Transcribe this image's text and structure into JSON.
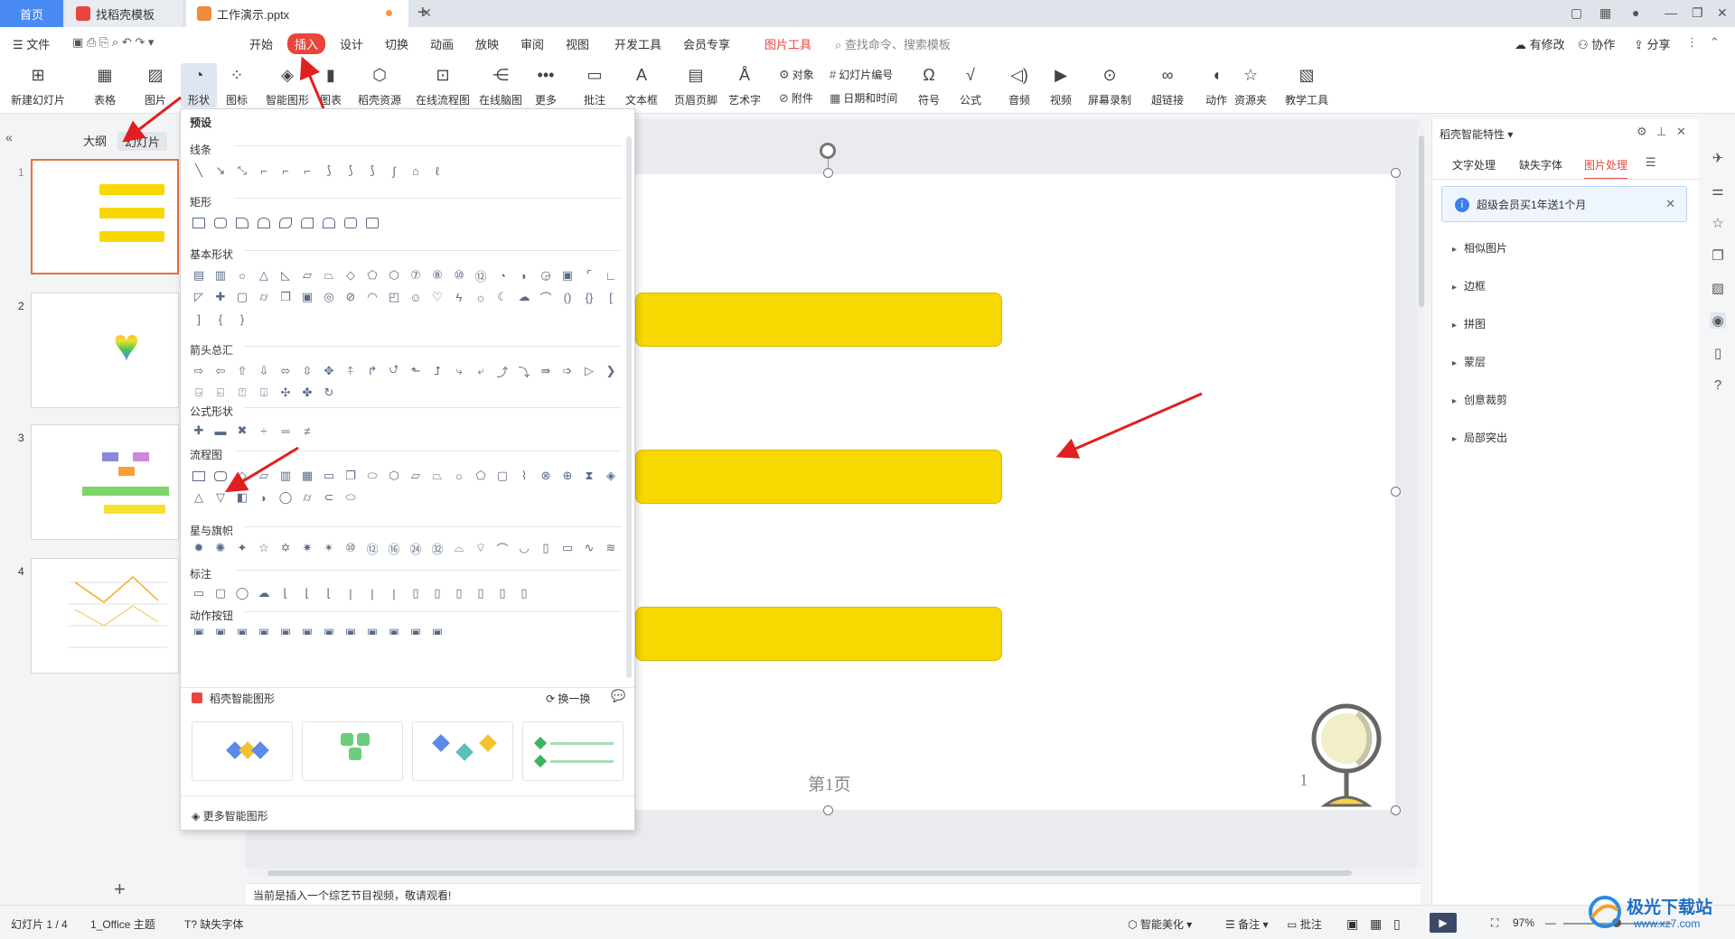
{
  "tabs": {
    "home": "首页",
    "template": "找稻壳模板",
    "document": "工作演示.pptx"
  },
  "menu": {
    "file": "文件",
    "start": "开始",
    "insert": "插入",
    "design": "设计",
    "switch": "切换",
    "animation": "动画",
    "show": "放映",
    "review": "审阅",
    "view": "视图",
    "dev": "开发工具",
    "vip": "会员专享",
    "picture_tools": "图片工具",
    "search": "查找命令、搜索模板",
    "modified": "有修改",
    "collab": "协作",
    "share": "分享"
  },
  "ribbon": {
    "new_slide": "新建幻灯片",
    "table": "表格",
    "picture": "图片",
    "shape": "形状",
    "icon": "图标",
    "smart_graphic": "智能图形",
    "chart": "图表",
    "docer_res": "稻壳资源",
    "online_flow": "在线流程图",
    "online_mind": "在线脑图",
    "more": "更多",
    "comment": "批注",
    "textbox": "文本框",
    "header_footer": "页眉页脚",
    "art_text": "艺术字",
    "object": "对象",
    "attachment": "附件",
    "slide_number": "幻灯片编号",
    "date_time": "日期和时间",
    "symbol": "符号",
    "formula": "公式",
    "audio": "音频",
    "video": "视频",
    "screen_rec": "屏幕录制",
    "hyperlink": "超链接",
    "action": "动作",
    "resource": "资源夹",
    "teach_tool": "教学工具"
  },
  "left_panel": {
    "outline": "大纲",
    "slides": "幻灯片",
    "thumbs": [
      "1",
      "2",
      "3",
      "4"
    ]
  },
  "shape_menu": {
    "preset": "预设",
    "sections": [
      "线条",
      "矩形",
      "基本形状",
      "箭头总汇",
      "公式形状",
      "流程图",
      "星与旗帜",
      "标注",
      "动作按钮"
    ],
    "smart_title": "稻壳智能图形",
    "refresh": "换一换",
    "more_smart": "更多智能图形"
  },
  "slide": {
    "page_label": "第1页",
    "page_num": "1"
  },
  "right_panel": {
    "title": "稻壳智能特性",
    "tabs": [
      "文字处理",
      "缺失字体",
      "图片处理"
    ],
    "promo": "超级会员买1年送1个月",
    "items": [
      "相似图片",
      "边框",
      "拼图",
      "蒙层",
      "创意裁剪",
      "局部突出"
    ]
  },
  "notes": "当前是插入一个综艺节目视频，敬请观看!",
  "status": {
    "slide_count": "幻灯片 1 / 4",
    "theme": "1_Office 主题",
    "missing_font": "缺失字体",
    "beautify": "智能美化",
    "notes": "备注",
    "comments": "批注",
    "zoom": "97%"
  },
  "watermark": "极光下载站",
  "watermark_url": "www.xz7.com",
  "colors": {
    "accent": "#e8453c",
    "tab_blue": "#4a8af4",
    "slide_yellow": "#f7d800"
  }
}
